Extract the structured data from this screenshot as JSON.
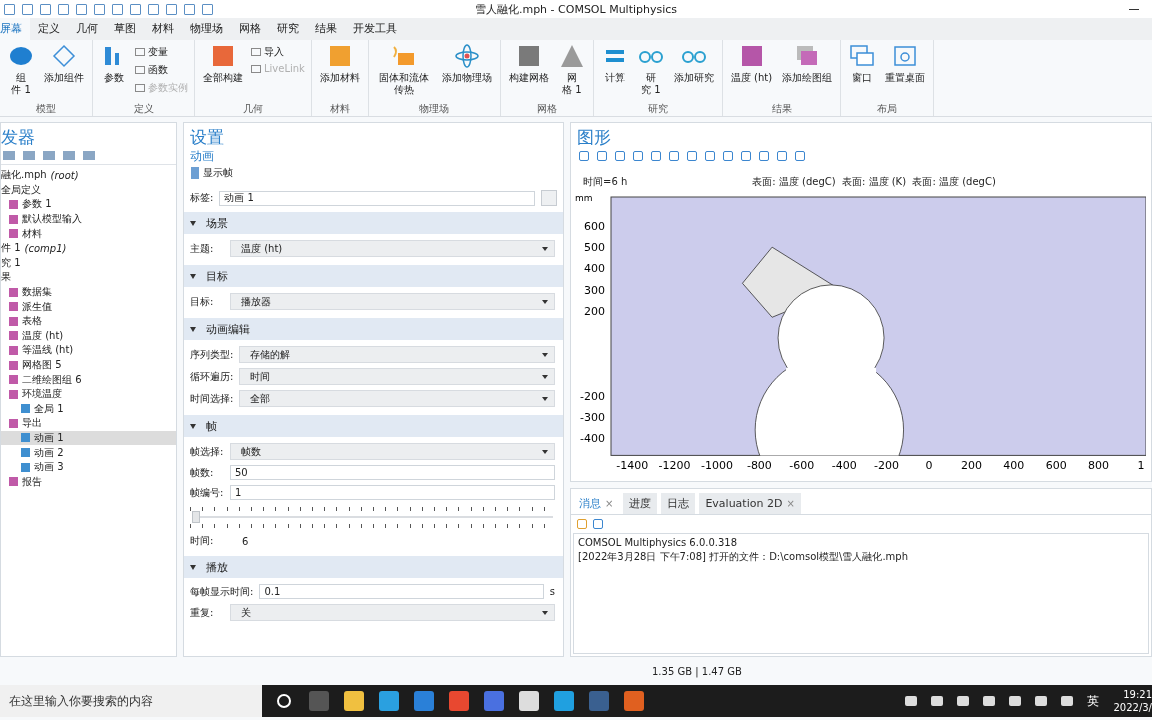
{
  "window": {
    "title": "雪人融化.mph - COMSOL Multiphysics"
  },
  "ribbon_tabs": [
    {
      "label": "屏幕",
      "selected": true
    },
    {
      "label": "定义",
      "selected": false
    },
    {
      "label": "几何",
      "selected": false
    },
    {
      "label": "草图",
      "selected": false
    },
    {
      "label": "材料",
      "selected": false
    },
    {
      "label": "物理场",
      "selected": false
    },
    {
      "label": "网格",
      "selected": false
    },
    {
      "label": "研究",
      "selected": false
    },
    {
      "label": "结果",
      "selected": false
    },
    {
      "label": "开发工具",
      "selected": false
    }
  ],
  "ribbon_groups": [
    {
      "label": "模型",
      "buttons": [
        {
          "kind": "stacked",
          "label": "组件 1"
        },
        {
          "kind": "large",
          "label": "添加组件"
        }
      ]
    },
    {
      "label": "定义",
      "buttons": [
        {
          "kind": "large",
          "label": "参数"
        },
        {
          "kind": "small",
          "label": "变量",
          "disabled": false
        },
        {
          "kind": "small",
          "label": "函数",
          "disabled": false
        },
        {
          "kind": "small",
          "label": "参数实例",
          "disabled": true
        }
      ]
    },
    {
      "label": "几何",
      "buttons": [
        {
          "kind": "large",
          "label": "全部构建"
        },
        {
          "kind": "small",
          "label": "导入",
          "disabled": false
        },
        {
          "kind": "small",
          "label": "LiveLink",
          "disabled": true
        }
      ]
    },
    {
      "label": "材料",
      "buttons": [
        {
          "kind": "large",
          "label": "添加材料"
        }
      ]
    },
    {
      "label": "物理场",
      "buttons": [
        {
          "kind": "large",
          "label": "固体和流体传热"
        },
        {
          "kind": "large",
          "label": "添加物理场"
        }
      ]
    },
    {
      "label": "网格",
      "buttons": [
        {
          "kind": "large",
          "label": "构建网格"
        },
        {
          "kind": "stacked",
          "label": "网格 1"
        }
      ]
    },
    {
      "label": "研究",
      "buttons": [
        {
          "kind": "large",
          "label": "计算"
        },
        {
          "kind": "stacked",
          "label": "研究 1"
        },
        {
          "kind": "large",
          "label": "添加研究"
        }
      ]
    },
    {
      "label": "结果",
      "buttons": [
        {
          "kind": "large",
          "label": "温度 (ht)"
        },
        {
          "kind": "large",
          "label": "添加绘图组"
        }
      ]
    },
    {
      "label": "布局",
      "buttons": [
        {
          "kind": "large",
          "label": "窗口"
        },
        {
          "kind": "large",
          "label": "重置桌面"
        }
      ]
    }
  ],
  "model_builder": {
    "title": "发器",
    "tree": [
      {
        "label": "融化.mph",
        "note": "(root)",
        "selected": false
      },
      {
        "label": "全局定义",
        "selected": false,
        "children": [
          {
            "label": "参数 1",
            "selected": false
          },
          {
            "label": "默认模型输入",
            "selected": false
          },
          {
            "label": "材料",
            "selected": false
          }
        ]
      },
      {
        "label": "件 1",
        "note": "(comp1)",
        "selected": false
      },
      {
        "label": "究 1",
        "selected": false
      },
      {
        "label": "果",
        "selected": false,
        "children": [
          {
            "label": "数据集",
            "selected": false
          },
          {
            "label": "派生值",
            "selected": false
          },
          {
            "label": "表格",
            "selected": false
          },
          {
            "label": "温度 (ht)",
            "selected": false
          },
          {
            "label": "等温线 (ht)",
            "selected": false
          },
          {
            "label": "网格图 5",
            "selected": false
          },
          {
            "label": "二维绘图组 6",
            "selected": false
          },
          {
            "label": "环境温度",
            "selected": false,
            "children": [
              {
                "label": "全局 1",
                "selected": false
              }
            ]
          },
          {
            "label": "导出",
            "selected": false,
            "children": [
              {
                "label": "动画 1",
                "selected": true
              },
              {
                "label": "动画 2",
                "selected": false
              },
              {
                "label": "动画 3",
                "selected": false
              }
            ]
          },
          {
            "label": "报告",
            "selected": false
          }
        ]
      }
    ]
  },
  "settings": {
    "title": "设置",
    "subtitle": "动画",
    "show_frame": "显示帧",
    "label_caption": "标签:",
    "label_value": "动画 1",
    "sections": [
      {
        "title": "场景",
        "expanded": true,
        "rows": [
          {
            "kind": "select",
            "label": "主题:",
            "value": "温度 (ht)"
          }
        ]
      },
      {
        "title": "目标",
        "expanded": true,
        "rows": [
          {
            "kind": "select",
            "label": "目标:",
            "value": "播放器"
          }
        ]
      },
      {
        "title": "动画编辑",
        "expanded": true,
        "rows": [
          {
            "kind": "select",
            "label": "序列类型:",
            "value": "存储的解"
          },
          {
            "kind": "select",
            "label": "循环遍历:",
            "value": "时间"
          },
          {
            "kind": "select",
            "label": "时间选择:",
            "value": "全部"
          }
        ]
      },
      {
        "title": "帧",
        "expanded": true,
        "rows": [
          {
            "kind": "select",
            "label": "帧选择:",
            "value": "帧数"
          },
          {
            "kind": "field",
            "label": "帧数:",
            "value": "50"
          },
          {
            "kind": "field",
            "label": "帧编号:",
            "value": "1"
          },
          {
            "kind": "slider",
            "level": 0
          },
          {
            "kind": "text",
            "label": "时间:",
            "value": "6"
          }
        ]
      },
      {
        "title": "播放",
        "expanded": true,
        "rows": [
          {
            "kind": "field",
            "label": "每帧显示时间:",
            "value": "0.1",
            "unit": "s"
          },
          {
            "kind": "select",
            "label": "重复:",
            "value": "关"
          }
        ]
      }
    ]
  },
  "graphics": {
    "title": "图形",
    "time_label": "时间=6 h",
    "plot_title": "表面: 温度 (degC)  表面: 温度 (K)  表面: 温度 (degC)",
    "unit": "mm",
    "yticks": [
      "600",
      "500",
      "400",
      "300",
      "200",
      "-200",
      "-300",
      "-400"
    ],
    "xticks": [
      "-1400",
      "-1200",
      "-1000",
      "-800",
      "-600",
      "-400",
      "-200",
      "0",
      "200",
      "400",
      "600",
      "800",
      "1"
    ]
  },
  "messages": {
    "tabs": [
      {
        "label": "消息",
        "selected": true,
        "close": "×"
      },
      {
        "label": "进度",
        "selected": false
      },
      {
        "label": "日志",
        "selected": false
      },
      {
        "label": "Evaluation 2D",
        "selected": false,
        "close": "×"
      }
    ],
    "lines": [
      "COMSOL Multiphysics 6.0.0.318",
      "[2022年3月28日 下午7:08] 打开的文件：D:\\comsol模型\\雪人融化.mph"
    ]
  },
  "status_bar": "1.35 GB | 1.47 GB",
  "taskbar": {
    "search_placeholder": "在这里输入你要搜索的内容",
    "input_method": "英",
    "time": "19:21",
    "date": "2022/3/"
  }
}
